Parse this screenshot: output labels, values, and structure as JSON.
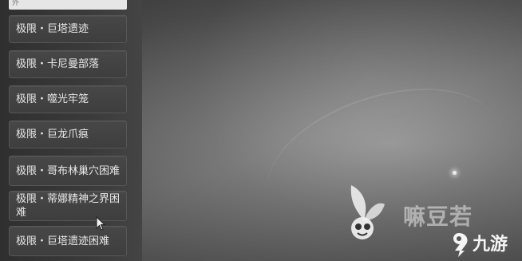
{
  "header": {
    "visible_text": "外"
  },
  "menu": {
    "items": [
      {
        "label": "极限・巨塔遗迹"
      },
      {
        "label": "极限・卡尼曼部落"
      },
      {
        "label": "极限・噬光牢笼"
      },
      {
        "label": "极限・巨龙爪痕"
      },
      {
        "label": "极限・哥布林巢穴困难"
      },
      {
        "label": "极限・蒂娜精神之界困难"
      },
      {
        "label": "极限・巨塔遗迹困难"
      }
    ]
  },
  "watermark": {
    "text": "嘛豆若",
    "brand_text": "九游"
  },
  "colors": {
    "menu_bg": "#434343",
    "menu_border": "#575757",
    "menu_text": "#e8e8e8",
    "top_bar": "#e6e6e6"
  },
  "icons": {
    "cursor": "mouse-pointer-icon",
    "watermark_logo": "leaf-mascot-logo",
    "brand_mark": "nine-game-logo"
  }
}
